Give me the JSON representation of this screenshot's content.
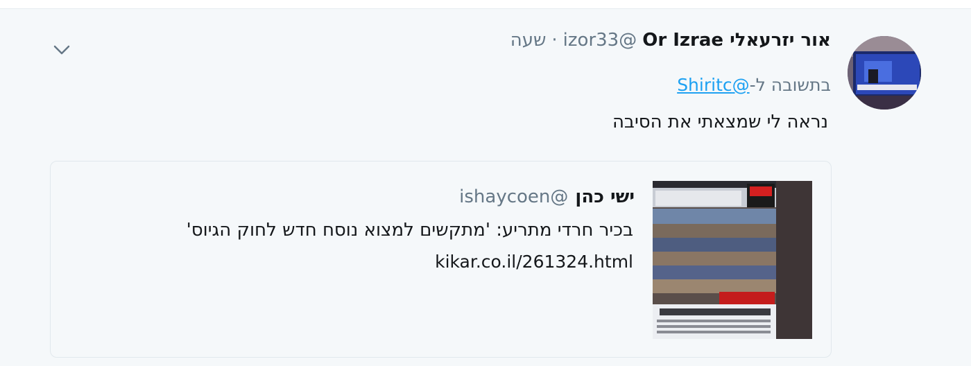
{
  "tweet": {
    "author_name": "אור יזרעאלי Or Izrae",
    "author_handle": "@izor33",
    "separator": "·",
    "time": "שעה",
    "reply_prefix": "בתשובה ל-",
    "reply_mention": "@Shiritc",
    "text": "נראה לי שמצאתי את הסיבה"
  },
  "quote": {
    "author_name": "ישי כהן",
    "author_handle": "@ishaycoen",
    "text": "בכיר חרדי מתריע: 'מתקשים למצוא נוסח חדש לחוק הגיוס'",
    "link": "kikar.co.il/261324.html"
  },
  "icons": {
    "menu": "chevron-down-icon",
    "avatar": "avatar-image",
    "thumbnail": "article-thumbnail"
  },
  "colors": {
    "background": "#f5f8fa",
    "link": "#1da1f2",
    "text": "#14171a",
    "secondary": "#657786"
  }
}
